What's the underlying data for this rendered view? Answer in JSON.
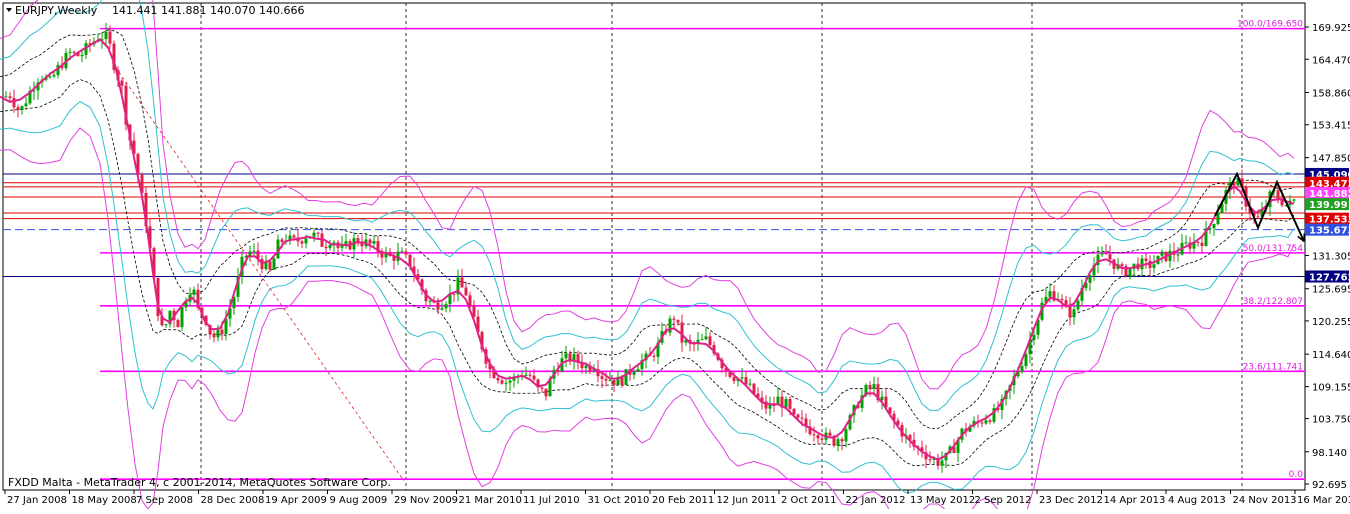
{
  "header": {
    "symbol_label": "EURJPY,Weekly",
    "ohlc": "141.441 141.881 140.070 140.666"
  },
  "footer": {
    "copyright": "FXDD Malta - MetaTrader 4, c 2001-2014, MetaQuotes Software Corp."
  },
  "colors": {
    "candle_up": "#00a000",
    "candle_down": "#e0204a",
    "fib_line": "#ff00ff",
    "band_outer": "#e040e0",
    "band_inner": "#30c0d0",
    "center_ma": "#000000",
    "ma_fast": "#e0208a",
    "support": "#e00000",
    "resistance": "#000080"
  },
  "chart_data": {
    "type": "candlestick",
    "timeframe": "Weekly",
    "ylim": [
      92.695,
      171.0
    ],
    "y_ticks": [
      "169.925",
      "164.470",
      "158.860",
      "153.415",
      "147.850",
      "142.270",
      "136.745",
      "131.305",
      "125.695",
      "120.255",
      "114.640",
      "109.155",
      "103.750",
      "98.140",
      "92.695"
    ],
    "x_ticks": [
      "27 Jan 2008",
      "18 May 2008",
      "7 Sep 2008",
      "28 Dec 2008",
      "19 Apr 2009",
      "9 Aug 2009",
      "29 Nov 2009",
      "21 Mar 2010",
      "11 Jul 2010",
      "31 Oct 2010",
      "20 Feb 2011",
      "12 Jun 2011",
      "2 Oct 2011",
      "22 Jan 2012",
      "13 May 2012",
      "2 Sep 2012",
      "23 Dec 2012",
      "14 Apr 2013",
      "4 Aug 2013",
      "24 Nov 2013",
      "16 Mar 2014"
    ],
    "fib_levels": [
      {
        "label": "100.0/169.650",
        "value": 169.65
      },
      {
        "label": "50.0/131.754",
        "value": 131.754
      },
      {
        "label": "38.2/122.807",
        "value": 122.807
      },
      {
        "label": "23.6/111.741",
        "value": 111.741
      },
      {
        "label": "0.0",
        "value": 93.5
      }
    ],
    "price_boxes": [
      {
        "label": "145.090",
        "value": 145.09,
        "color": "#000080"
      },
      {
        "label": "143.473",
        "value": 143.6,
        "color": "#e00000"
      },
      {
        "label": "141.883",
        "value": 141.883,
        "color": "#ff40ff"
      },
      {
        "label": "139.991",
        "value": 139.991,
        "color": "#20a020"
      },
      {
        "label": "137.533",
        "value": 137.533,
        "color": "#e00000"
      },
      {
        "label": "135.673",
        "value": 135.673,
        "color": "#3050e0"
      },
      {
        "label": "127.762",
        "value": 127.762,
        "color": "#000080"
      }
    ],
    "horizontal_lines": [
      {
        "value": 145.09,
        "color": "#000080"
      },
      {
        "value": 143.6,
        "color": "#e00000"
      },
      {
        "value": 142.9,
        "color": "#e00000"
      },
      {
        "value": 141.2,
        "color": "#e00000"
      },
      {
        "value": 138.5,
        "color": "#e00000"
      },
      {
        "value": 137.533,
        "color": "#e00000"
      },
      {
        "value": 135.673,
        "color": "#3050e0",
        "dashed": true
      },
      {
        "value": 127.762,
        "color": "#000080"
      }
    ],
    "price_path": [
      [
        0,
        157.8
      ],
      [
        10,
        158.5
      ],
      [
        20,
        155.5
      ],
      [
        30,
        159.0
      ],
      [
        40,
        162.0
      ],
      [
        50,
        160.5
      ],
      [
        60,
        163.5
      ],
      [
        70,
        165.5
      ],
      [
        80,
        165.0
      ],
      [
        90,
        167.0
      ],
      [
        100,
        168.5
      ],
      [
        108,
        168.0
      ],
      [
        115,
        163.0
      ],
      [
        122,
        159.5
      ],
      [
        128,
        152.0
      ],
      [
        135,
        148.0
      ],
      [
        142,
        141.0
      ],
      [
        148,
        135.0
      ],
      [
        153,
        128.0
      ],
      [
        158,
        122.0
      ],
      [
        163,
        118.0
      ],
      [
        170,
        122.0
      ],
      [
        178,
        120.0
      ],
      [
        185,
        124.0
      ],
      [
        192,
        126.5
      ],
      [
        198,
        122.0
      ],
      [
        205,
        121.0
      ],
      [
        212,
        117.5
      ],
      [
        220,
        118.0
      ],
      [
        228,
        121.5
      ],
      [
        235,
        125.0
      ],
      [
        242,
        130.0
      ],
      [
        248,
        132.0
      ],
      [
        255,
        131.5
      ],
      [
        262,
        130.0
      ],
      [
        270,
        128.5
      ],
      [
        278,
        133.0
      ],
      [
        285,
        134.5
      ],
      [
        292,
        133.5
      ],
      [
        300,
        134.0
      ],
      [
        308,
        135.0
      ],
      [
        316,
        134.5
      ],
      [
        324,
        133.0
      ],
      [
        332,
        134.5
      ],
      [
        340,
        132.0
      ],
      [
        348,
        133.0
      ],
      [
        356,
        134.0
      ],
      [
        364,
        133.5
      ],
      [
        372,
        133.0
      ],
      [
        380,
        132.0
      ],
      [
        390,
        131.0
      ],
      [
        400,
        131.5
      ],
      [
        410,
        130.0
      ],
      [
        418,
        127.0
      ],
      [
        426,
        124.0
      ],
      [
        434,
        123.0
      ],
      [
        442,
        123.5
      ],
      [
        450,
        124.5
      ],
      [
        458,
        126.5
      ],
      [
        466,
        125.0
      ],
      [
        474,
        120.0
      ],
      [
        482,
        116.0
      ],
      [
        490,
        112.0
      ],
      [
        498,
        111.0
      ],
      [
        506,
        110.0
      ],
      [
        514,
        110.5
      ],
      [
        522,
        111.5
      ],
      [
        530,
        111.0
      ],
      [
        538,
        108.5
      ],
      [
        546,
        108.0
      ],
      [
        554,
        112.0
      ],
      [
        562,
        113.5
      ],
      [
        570,
        114.0
      ],
      [
        578,
        113.5
      ],
      [
        586,
        112.5
      ],
      [
        594,
        113.0
      ],
      [
        602,
        111.0
      ],
      [
        610,
        110.5
      ],
      [
        618,
        110.0
      ],
      [
        626,
        111.0
      ],
      [
        634,
        112.5
      ],
      [
        642,
        113.5
      ],
      [
        650,
        114.0
      ],
      [
        658,
        116.0
      ],
      [
        666,
        119.0
      ],
      [
        674,
        121.0
      ],
      [
        682,
        117.0
      ],
      [
        690,
        116.0
      ],
      [
        698,
        116.5
      ],
      [
        706,
        117.0
      ],
      [
        714,
        115.5
      ],
      [
        722,
        113.0
      ],
      [
        730,
        111.5
      ],
      [
        738,
        110.5
      ],
      [
        746,
        109.5
      ],
      [
        754,
        108.0
      ],
      [
        762,
        106.0
      ],
      [
        770,
        105.5
      ],
      [
        778,
        107.0
      ],
      [
        786,
        106.0
      ],
      [
        794,
        103.5
      ],
      [
        802,
        103.0
      ],
      [
        810,
        102.0
      ],
      [
        818,
        101.5
      ],
      [
        826,
        100.5
      ],
      [
        834,
        100.0
      ],
      [
        842,
        101.0
      ],
      [
        850,
        103.5
      ],
      [
        858,
        106.5
      ],
      [
        866,
        108.5
      ],
      [
        874,
        109.0
      ],
      [
        882,
        106.5
      ],
      [
        890,
        104.0
      ],
      [
        898,
        102.5
      ],
      [
        906,
        100.5
      ],
      [
        914,
        99.0
      ],
      [
        922,
        98.5
      ],
      [
        930,
        97.0
      ],
      [
        938,
        96.5
      ],
      [
        946,
        97.0
      ],
      [
        954,
        99.0
      ],
      [
        962,
        101.5
      ],
      [
        970,
        102.5
      ],
      [
        978,
        103.0
      ],
      [
        986,
        104.0
      ],
      [
        994,
        104.5
      ],
      [
        1002,
        106.0
      ],
      [
        1010,
        109.0
      ],
      [
        1018,
        112.0
      ],
      [
        1026,
        115.0
      ],
      [
        1034,
        119.0
      ],
      [
        1042,
        123.0
      ],
      [
        1050,
        125.0
      ],
      [
        1058,
        124.5
      ],
      [
        1066,
        122.0
      ],
      [
        1074,
        121.5
      ],
      [
        1082,
        126.0
      ],
      [
        1090,
        129.0
      ],
      [
        1098,
        130.5
      ],
      [
        1106,
        131.5
      ],
      [
        1114,
        130.0
      ],
      [
        1122,
        128.5
      ],
      [
        1130,
        129.0
      ],
      [
        1138,
        130.0
      ],
      [
        1146,
        129.5
      ],
      [
        1154,
        130.0
      ],
      [
        1162,
        131.0
      ],
      [
        1170,
        131.5
      ],
      [
        1178,
        132.0
      ],
      [
        1186,
        133.0
      ],
      [
        1194,
        133.5
      ],
      [
        1202,
        134.0
      ],
      [
        1210,
        136.0
      ],
      [
        1218,
        139.0
      ],
      [
        1226,
        142.0
      ],
      [
        1234,
        144.0
      ],
      [
        1240,
        143.0
      ],
      [
        1248,
        139.5
      ],
      [
        1256,
        137.0
      ],
      [
        1264,
        139.0
      ],
      [
        1272,
        142.0
      ],
      [
        1280,
        141.0
      ],
      [
        1288,
        139.5
      ],
      [
        1294,
        140.6
      ]
    ],
    "wave_projection": [
      [
        1215,
        138.0
      ],
      [
        1237,
        145.1
      ],
      [
        1258,
        136.0
      ],
      [
        1277,
        143.7
      ],
      [
        1304,
        133.7
      ]
    ],
    "annotations": []
  }
}
